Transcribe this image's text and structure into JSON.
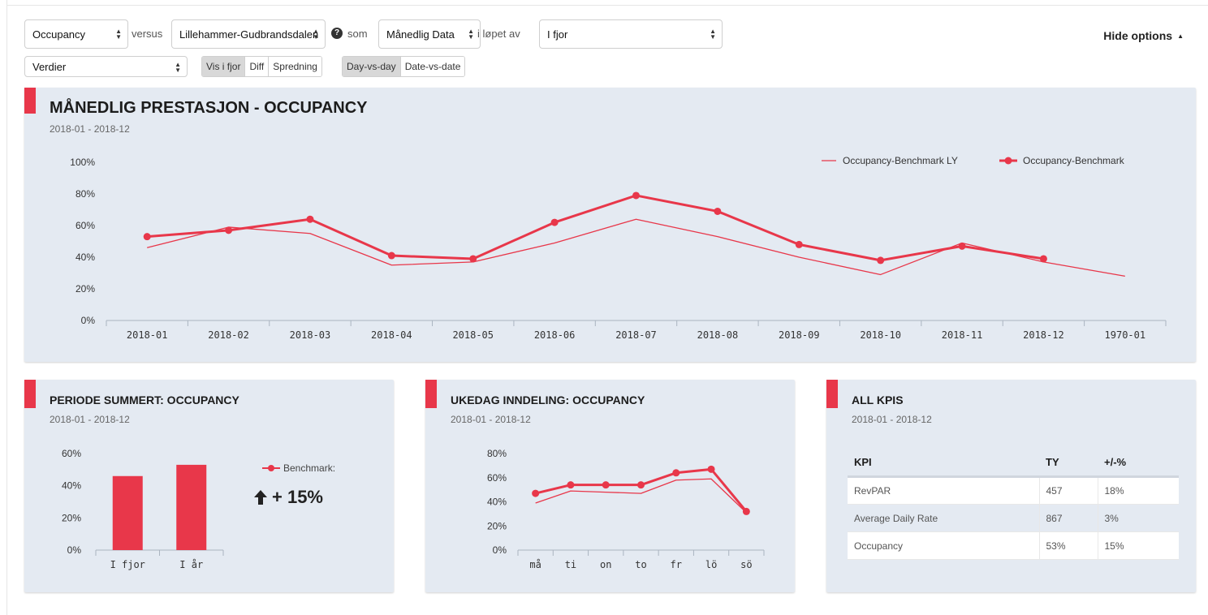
{
  "toolbar": {
    "metric_select": "Occupancy",
    "versus_label": "versus",
    "compare_select": "Lillehammer-Gudbrandsdalen",
    "som_label": "som",
    "granularity_select": "Månedlig Data",
    "period_label": "i løpet av",
    "period_select": "I fjor",
    "values_select": "Verdier",
    "view_buttons": [
      "Vis i fjor",
      "Diff",
      "Spredning"
    ],
    "mode_buttons": [
      "Day-vs-day",
      "Date-vs-date"
    ],
    "hide_options": "Hide options"
  },
  "main_panel": {
    "title": "MÅNEDLIG PRESTASJON - OCCUPANCY",
    "subtitle": "2018-01 - 2018-12",
    "chart_data": {
      "type": "line",
      "categories": [
        "2018-01",
        "2018-02",
        "2018-03",
        "2018-04",
        "2018-05",
        "2018-06",
        "2018-07",
        "2018-08",
        "2018-09",
        "2018-10",
        "2018-11",
        "2018-12",
        "1970-01"
      ],
      "y_ticks": [
        "0%",
        "20%",
        "40%",
        "60%",
        "80%",
        "100%"
      ],
      "ylim": [
        0,
        100
      ],
      "legend_position": "top-right",
      "series": [
        {
          "name": "Occupancy-Benchmark LY",
          "style": "thin line",
          "color": "#e8374a",
          "values": [
            46,
            59,
            55,
            35,
            37,
            49,
            64,
            53,
            40,
            29,
            49,
            37,
            28
          ]
        },
        {
          "name": "Occupancy-Benchmark",
          "style": "thick line with markers",
          "color": "#e8374a",
          "values": [
            53,
            57,
            64,
            41,
            39,
            62,
            79,
            69,
            48,
            38,
            47,
            39,
            null
          ]
        }
      ]
    }
  },
  "periode_panel": {
    "title": "PERIODE SUMMERT: OCCUPANCY",
    "subtitle": "2018-01 - 2018-12",
    "legend": "Benchmark:",
    "change_text": "+ 15%",
    "change_direction": "up",
    "chart_data": {
      "type": "bar",
      "categories": [
        "I fjor",
        "I år"
      ],
      "values": [
        46,
        53
      ],
      "y_ticks": [
        "0%",
        "20%",
        "40%",
        "60%"
      ],
      "ylim": [
        0,
        60
      ],
      "color": "#e8374a"
    }
  },
  "ukedag_panel": {
    "title": "UKEDAG INNDELING: OCCUPANCY",
    "subtitle": "2018-01 - 2018-12",
    "chart_data": {
      "type": "line",
      "categories": [
        "må",
        "ti",
        "on",
        "to",
        "fr",
        "lö",
        "sö"
      ],
      "y_ticks": [
        "0%",
        "20%",
        "40%",
        "60%",
        "80%"
      ],
      "ylim": [
        0,
        80
      ],
      "series": [
        {
          "style": "thin line",
          "color": "#e8374a",
          "values": [
            39,
            49,
            48,
            47,
            58,
            59,
            31
          ]
        },
        {
          "style": "thick line with markers",
          "color": "#e8374a",
          "values": [
            47,
            54,
            54,
            54,
            64,
            67,
            32
          ]
        }
      ]
    }
  },
  "kpi_panel": {
    "title": "ALL KPIS",
    "subtitle": "2018-01 - 2018-12",
    "headers": [
      "KPI",
      "TY",
      "+/-%"
    ],
    "rows": [
      [
        "RevPAR",
        "457",
        "18%"
      ],
      [
        "Average Daily Rate",
        "867",
        "3%"
      ],
      [
        "Occupancy",
        "53%",
        "15%"
      ]
    ]
  },
  "colors": {
    "accent": "#e8374a",
    "panel_bg": "#e4eaf2"
  }
}
